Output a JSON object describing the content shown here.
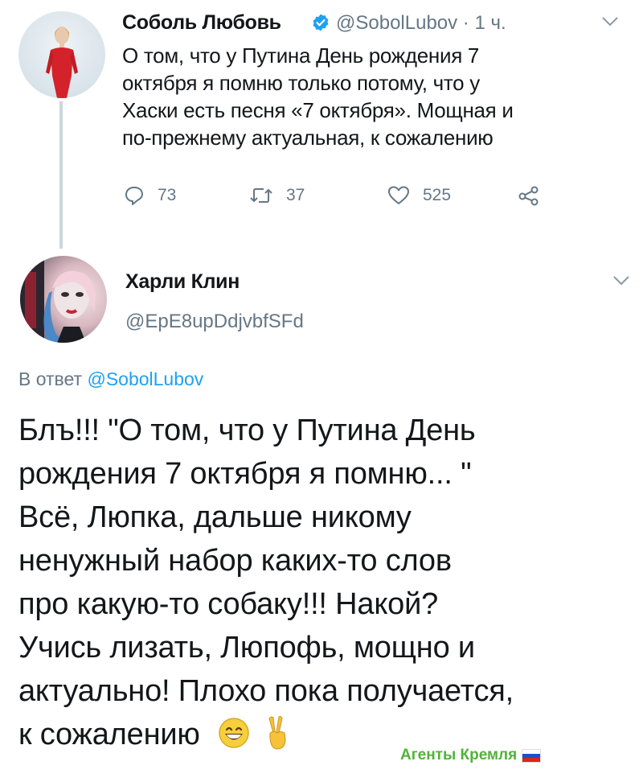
{
  "tweet1": {
    "author_name": "Соболь Любовь",
    "handle_time": "@SobolLubov · 1 ч.",
    "verified_icon": "verified-badge-icon",
    "lines": [
      "О том, что у Путина День рождения 7",
      "октября я помню только потому, что у",
      "Хаски есть песня «7 октября». Мощная и",
      "по-прежнему актуальная, к сожалению"
    ],
    "actions": {
      "reply_count": "73",
      "retweet_count": "37",
      "like_count": "525"
    }
  },
  "tweet2": {
    "author_name": "Харли Клин",
    "handle": "@EpE8upDdjvbfSFd",
    "reply_prefix": "В ответ",
    "reply_mention": "@SobolLubov",
    "lines": [
      "Блъ!!! \"О том, что у Путина День",
      "рождения 7 октября я помню... \"",
      "Всё, Люпка, дальше никому",
      "ненужный набор каких-то слов",
      "про какую-то собаку!!! Накой?",
      "Учись лизать, Люпофь, мощно и",
      "актуально! Плохо пока получается,",
      "к сожалению"
    ],
    "emojis": [
      "grinning-face-icon",
      "victory-hand-icon"
    ]
  },
  "watermark": "Агенты Кремля",
  "colors": {
    "text": "#14171a",
    "secondary": "#657786",
    "link": "#1da1f2",
    "verified": "#1da1f2",
    "watermark": "#52b23a",
    "thread_line": "#ccd6dd"
  }
}
